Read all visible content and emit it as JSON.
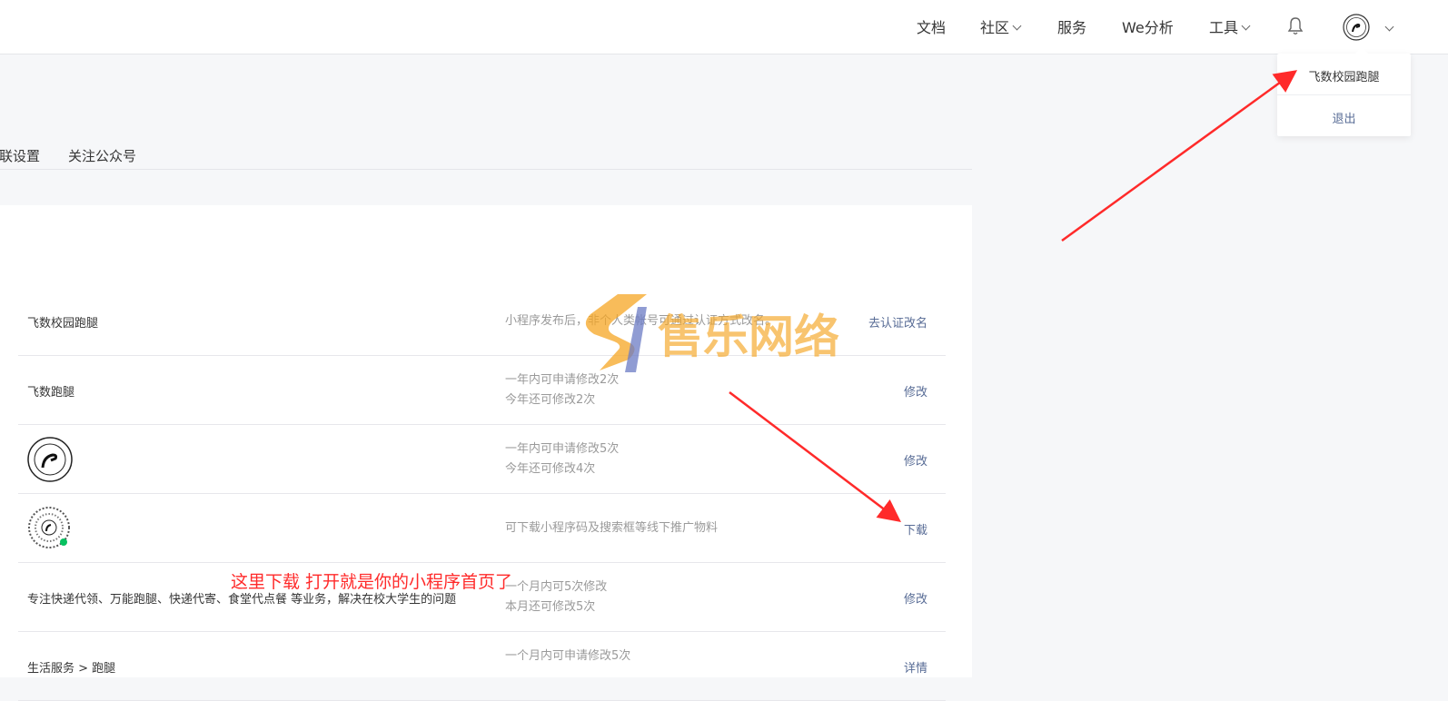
{
  "header": {
    "nav": [
      {
        "label": "文档"
      },
      {
        "label": "社区"
      },
      {
        "label": "服务"
      },
      {
        "label": "We分析"
      },
      {
        "label": "工具"
      }
    ]
  },
  "account_menu": {
    "name": "飞数校园跑腿",
    "logout": "退出"
  },
  "tabs": [
    {
      "label": "关联设置"
    },
    {
      "label": "关注公众号"
    }
  ],
  "settings": {
    "rows": [
      {
        "label": "飞数校园跑腿",
        "desc": [
          "小程序发布后，非个人类帐号可通过认证方式改名。"
        ],
        "action": "去认证改名"
      },
      {
        "label": "飞数跑腿",
        "desc": [
          "一年内可申请修改2次",
          "今年还可修改2次"
        ],
        "action": "修改"
      },
      {
        "label": "",
        "desc": [
          "一年内可申请修改5次",
          "今年还可修改4次"
        ],
        "action": "修改"
      },
      {
        "label": "",
        "desc": [
          "可下载小程序码及搜索框等线下推广物料"
        ],
        "action": "下载"
      },
      {
        "label": "专注快递代领、万能跑腿、快递代寄、食堂代点餐 等业务，解决在校大学生的问题",
        "desc": [
          "一个月内可5次修改",
          "本月还可修改5次"
        ],
        "action": "修改"
      },
      {
        "label": "生活服务 > 跑腿",
        "desc": [
          "一个月内可申请修改5次"
        ],
        "action": "详情"
      }
    ]
  },
  "annotation": {
    "text": "这里下载   打开就是你的小程序首页了",
    "color": "#ff2a2a"
  },
  "watermark": {
    "text": "售乐网络"
  },
  "colors": {
    "link": "#576b95",
    "muted": "#9a9a9a",
    "background": "#f6f7f9",
    "annotation": "#ff2a2a"
  }
}
